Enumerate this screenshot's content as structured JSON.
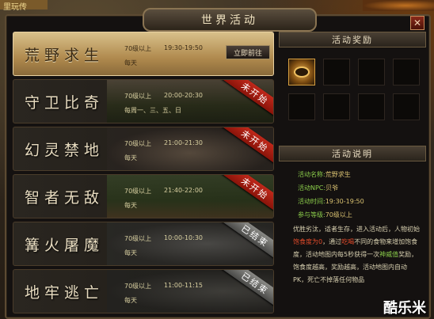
{
  "window": {
    "title": "世界活动",
    "close_label": "✕"
  },
  "bg_top_left": "里玩传",
  "activities": [
    {
      "name": "荒野求生",
      "level": "70级以上",
      "time": "19:30-19:50",
      "days": "每天",
      "button": "立即前往",
      "status": ""
    },
    {
      "name": "守卫比奇",
      "level": "70级以上",
      "time": "20:00-20:30",
      "days": "每周一、三、五、日",
      "button": "",
      "status": "未开始"
    },
    {
      "name": "幻灵禁地",
      "level": "70级以上",
      "time": "21:00-21:30",
      "days": "每天",
      "button": "",
      "status": "未开始"
    },
    {
      "name": "智者无敌",
      "level": "70级以上",
      "time": "21:40-22:00",
      "days": "每天",
      "button": "",
      "status": "未开始"
    },
    {
      "name": "篝火屠魔",
      "level": "70级以上",
      "time": "10:00-10:30",
      "days": "每天",
      "button": "",
      "status": "已结束"
    },
    {
      "name": "地牢逃亡",
      "level": "70级以上",
      "time": "11:00-11:15",
      "days": "每天",
      "button": "",
      "status": "已结束"
    }
  ],
  "reward_panel": {
    "title": "活动奖励"
  },
  "info_panel": {
    "title": "活动说明",
    "fields": [
      {
        "key": "活动名称:",
        "value": "荒野求生"
      },
      {
        "key": "活动NPC:",
        "value": "贝爷"
      },
      {
        "key": "活动时间:",
        "value": "19:30-19:50"
      },
      {
        "key": "参与等级:",
        "value": "70级以上"
      }
    ],
    "desc_parts": [
      {
        "text": "优胜劣汰，适者生存，进入活动后，人物初始",
        "cls": ""
      },
      {
        "text": "饱食度为0",
        "cls": "red"
      },
      {
        "text": "，通过",
        "cls": ""
      },
      {
        "text": "吃喝",
        "cls": "red"
      },
      {
        "text": "不同的食物来增加饱食度，活动地图内每5秒获得一次",
        "cls": ""
      },
      {
        "text": "神威值",
        "cls": "green"
      },
      {
        "text": "奖励，饱食度越高，奖励越高，活动地图内自动PK，死亡不掉落任何物品",
        "cls": ""
      }
    ]
  },
  "watermark": "酷乐米",
  "colors": {
    "accent": "#d8b070",
    "ribbon_red": "#c0281a",
    "ribbon_grey": "#8a8a86"
  }
}
